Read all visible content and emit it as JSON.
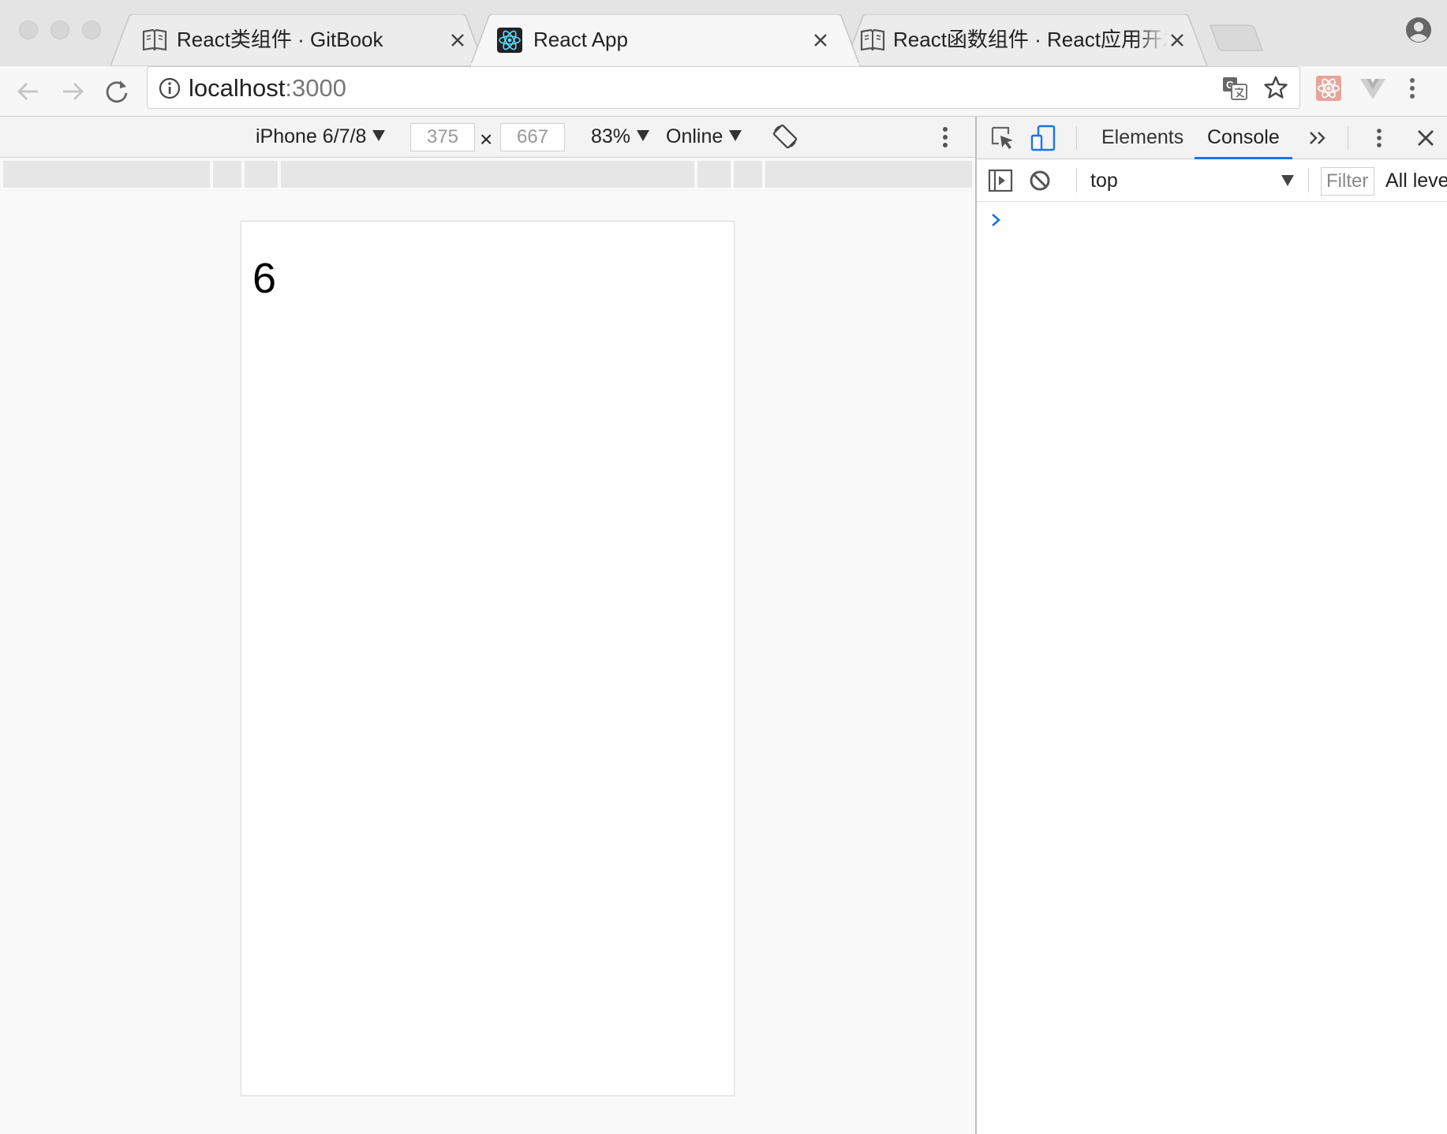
{
  "browser": {
    "tabs": [
      {
        "title": "React类组件 · GitBook",
        "icon": "book-icon",
        "active": false
      },
      {
        "title": "React App",
        "icon": "react-logo-icon",
        "active": true
      },
      {
        "title": "React函数组件 · React应用开发",
        "icon": "book-icon",
        "active": false
      }
    ],
    "address": {
      "host": "localhost",
      "port": ":3000"
    }
  },
  "device_toolbar": {
    "device": "iPhone 6/7/8",
    "width": "375",
    "height": "667",
    "separator": "×",
    "zoom": "83%",
    "network": "Online"
  },
  "page": {
    "count": "6"
  },
  "devtools": {
    "tabs": {
      "elements": "Elements",
      "console": "Console"
    },
    "console": {
      "context": "top",
      "filter_placeholder": "Filter",
      "levels": "All leve"
    }
  },
  "colors": {
    "accent": "#1a73e8",
    "prompt": "#1a73e8",
    "react": "#61dafb"
  }
}
